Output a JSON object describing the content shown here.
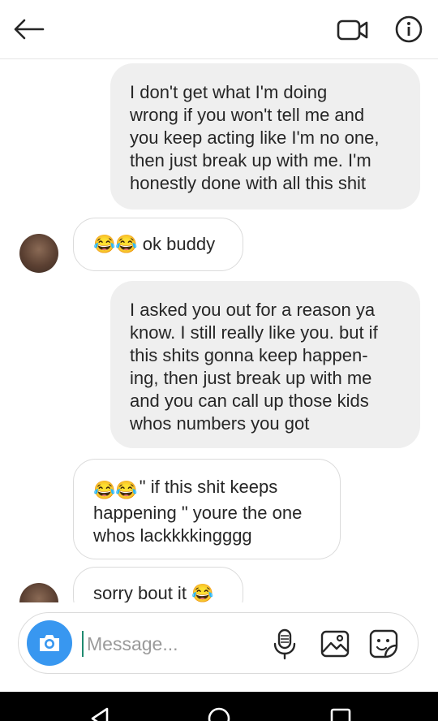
{
  "header": {
    "back_icon": "arrow-left-icon",
    "video_icon": "video-camera-icon",
    "info_icon": "info-icon"
  },
  "thread": {
    "messages": [
      {
        "direction": "out",
        "text": "I don't get what I'm doing\nwrong if you won't tell me and\nyou keep acting like I'm no one,\nthen just break up with me. I'm\nhonestly done with all this shit"
      },
      {
        "direction": "in",
        "emoji": "😂😂",
        "text": "ok buddy"
      },
      {
        "direction": "out",
        "text": "I asked you out for a reason ya\nknow. I still really like you. but if\nthis shits gonna keep happen-\ning, then just break up with me\nand you can call up those kids\nwhos numbers you got"
      },
      {
        "direction": "in",
        "emoji": "😂😂",
        "text": "\" if this shit keeps\nhappening \" youre the one\nwhos lackkkkingggg"
      },
      {
        "direction": "in",
        "text": "sorry bout it",
        "emoji": "😂"
      }
    ]
  },
  "composer": {
    "placeholder": "Message...",
    "camera_icon": "camera-icon",
    "mic_icon": "microphone-icon",
    "gallery_icon": "gallery-icon",
    "sticker_icon": "sticker-icon"
  },
  "colors": {
    "accent": "#3897f0",
    "outgoing_bubble": "#efefef",
    "incoming_border": "#dbdbdb",
    "nav_bar": "#000000"
  }
}
